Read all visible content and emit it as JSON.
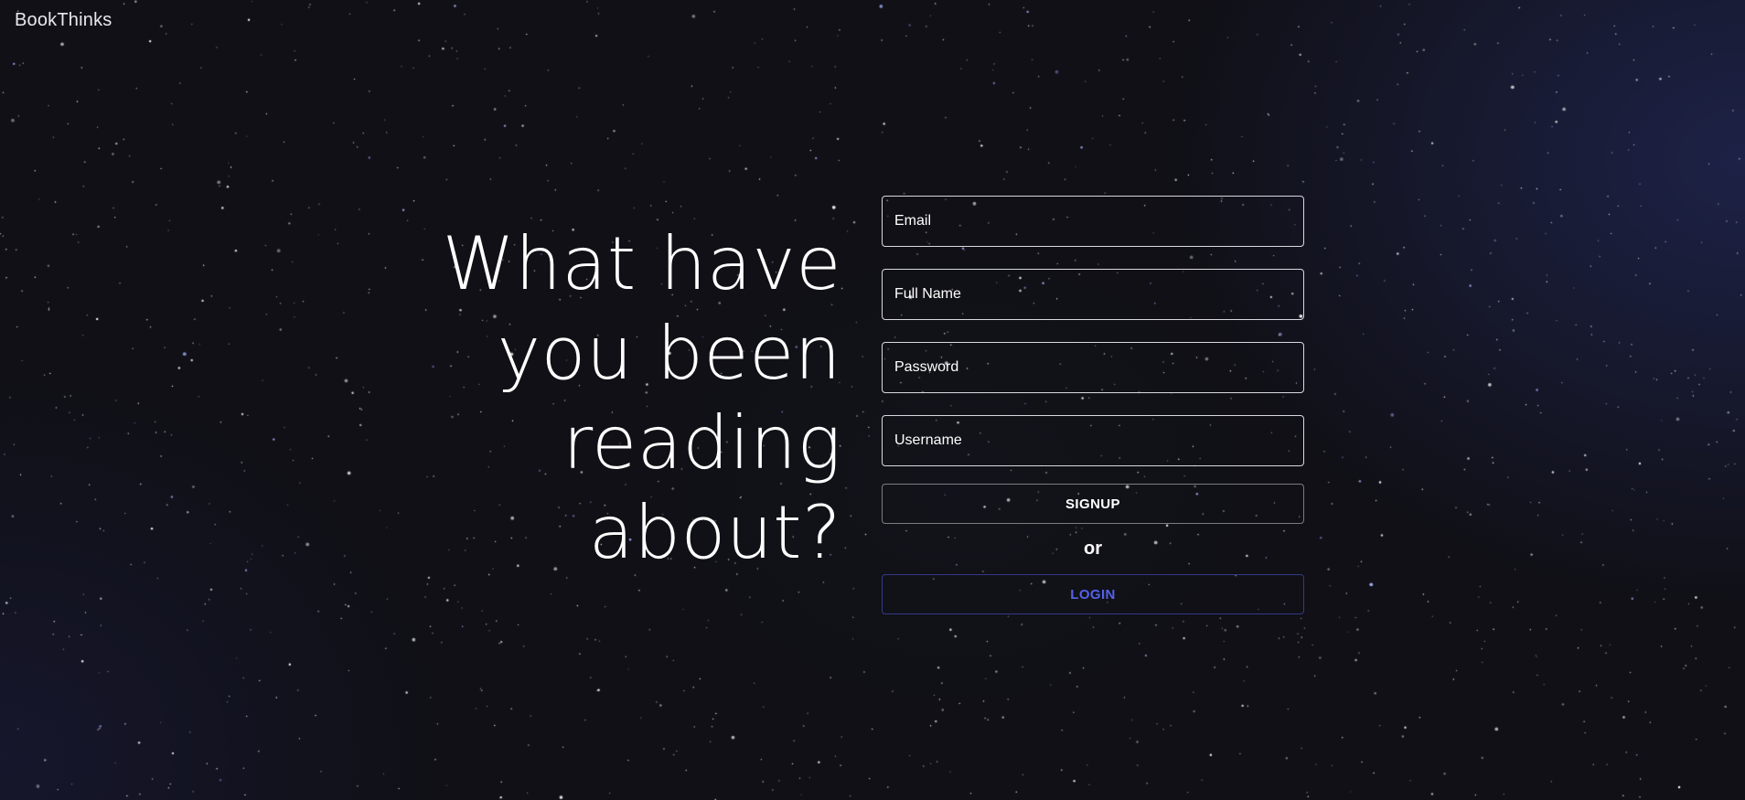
{
  "brand": {
    "name": "BookThinks"
  },
  "hero": {
    "headline_lines": [
      "What have",
      "you been",
      "reading",
      "about?"
    ]
  },
  "signup_form": {
    "email_placeholder": "Email",
    "fullname_placeholder": "Full Name",
    "password_placeholder": "Password",
    "username_placeholder": "Username",
    "signup_label": "SIGNUP",
    "separator": "or",
    "login_label": "LOGIN"
  },
  "colors": {
    "background": "#101016",
    "text": "#ffffff",
    "accent": "#5561e8"
  }
}
